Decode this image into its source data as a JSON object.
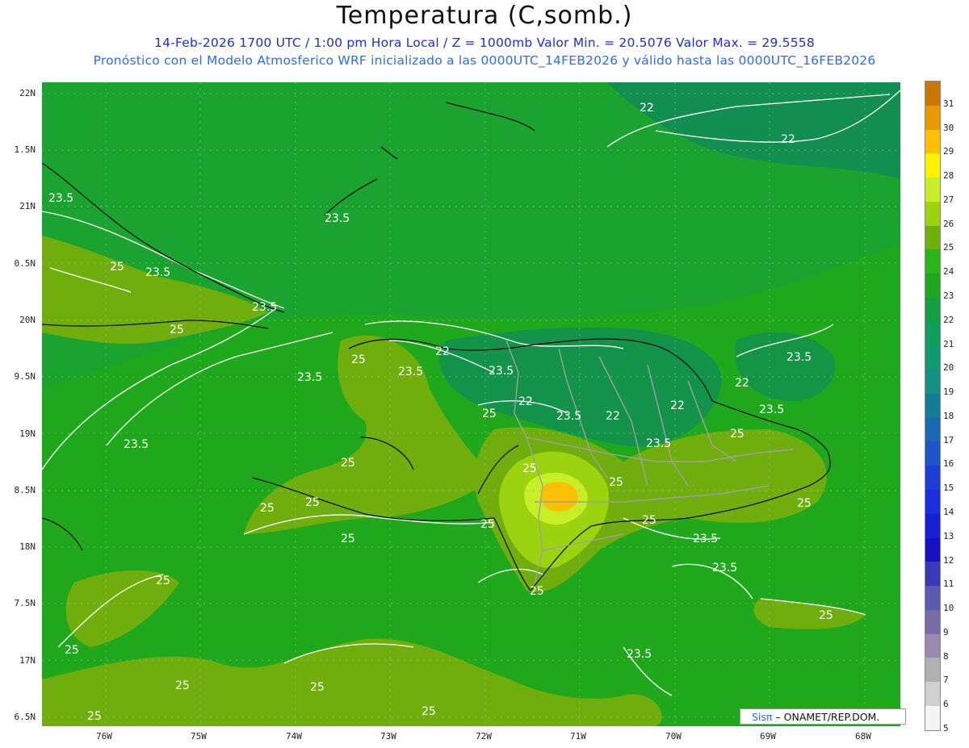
{
  "title": "Temperatura (C,somb.)",
  "subtitle_line1": "14-Feb-2026  1700 UTC / 1:00 pm Hora Local / Z = 1000mb    Valor Min. = 20.5076  Valor Max. = 29.5558",
  "subtitle_line2": "Pronóstico con el Modelo Atmosferico WRF inicializado a las 0000UTC_14FEB2026 y válido hasta las  0000UTC_16FEB2026",
  "lat_labels": [
    "22N",
    "1.5N",
    "21N",
    "0.5N",
    "20N",
    "9.5N",
    "19N",
    "8.5N",
    "18N",
    "7.5N",
    "17N",
    "6.5N"
  ],
  "lon_labels": [
    "76W",
    "75W",
    "74W",
    "73W",
    "72W",
    "71W",
    "70W",
    "69W",
    "68W"
  ],
  "colorbar": {
    "labels": [
      "31",
      "30",
      "29",
      "28",
      "27",
      "26",
      "25",
      "24",
      "23",
      "22",
      "21",
      "20",
      "19",
      "18",
      "17",
      "16",
      "15",
      "14",
      "13",
      "12",
      "11",
      "10",
      "9",
      "8",
      "7",
      "6",
      "5"
    ],
    "colors": [
      "#c87800",
      "#e69a00",
      "#ffc000",
      "#fff200",
      "#c8ee28",
      "#9bd40e",
      "#6fae0c",
      "#2bb41c",
      "#1fa81c",
      "#169f40",
      "#109e5c",
      "#0f9a70",
      "#139080",
      "#167c96",
      "#1a68b2",
      "#1c55c8",
      "#1b3fd6",
      "#1a2ee0",
      "#1820d6",
      "#1610c2",
      "#3a3ab8",
      "#5a5ab0",
      "#7a6aa8",
      "#9a8ab0",
      "#b0b0b0",
      "#d0d0d0",
      "#f5f5f5"
    ]
  },
  "contour_labels": [
    "22",
    "22",
    "23.5",
    "23.5",
    "23.5",
    "23.5",
    "25",
    "25",
    "23.5",
    "23.5",
    "25",
    "22",
    "23.5",
    "22",
    "23.5",
    "22",
    "23.5",
    "22",
    "23.5",
    "23.5",
    "22",
    "25",
    "25",
    "23.5",
    "25",
    "25",
    "25",
    "25",
    "25",
    "25",
    "25",
    "25",
    "25",
    "23.5",
    "23.5",
    "25",
    "25",
    "23.5",
    "25",
    "25",
    "25",
    "25",
    "25",
    "25"
  ],
  "credit": {
    "sis": "Sisπ",
    "text": "– ONAMET/REP.DOM."
  }
}
